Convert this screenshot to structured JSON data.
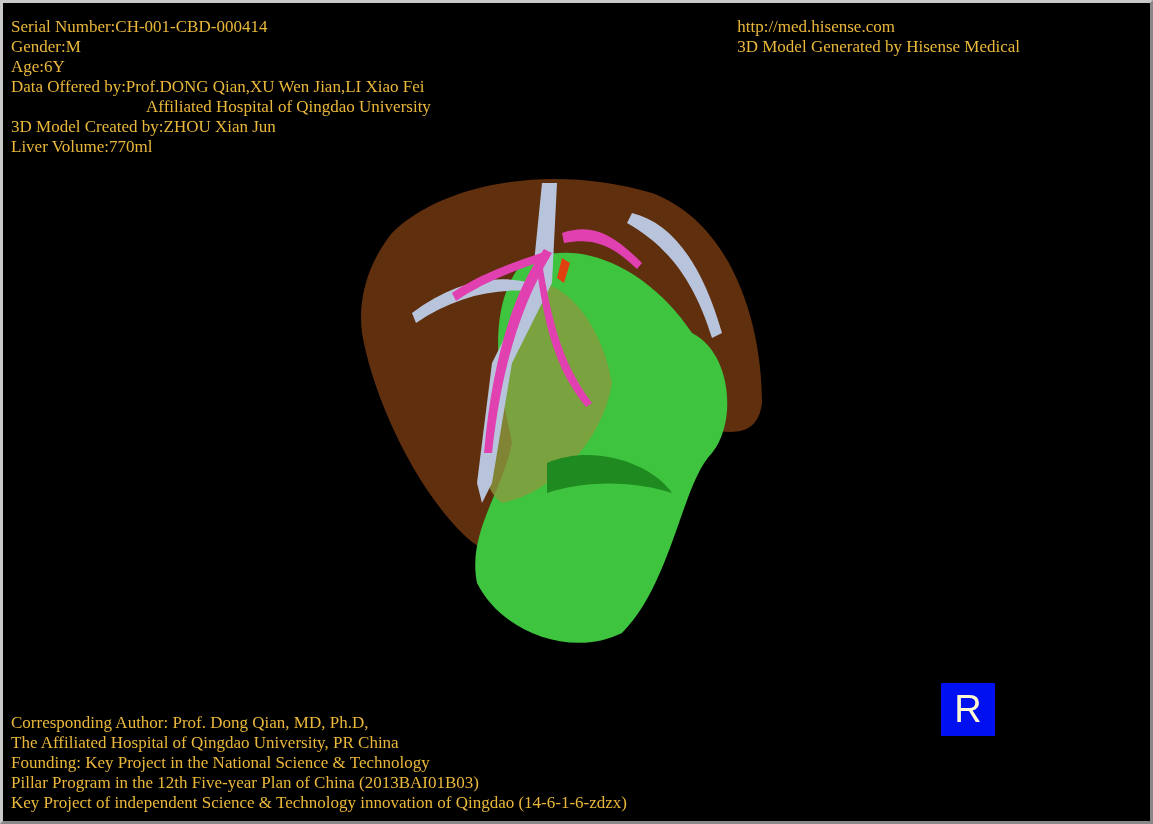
{
  "info_lines": [
    {
      "kind": "line",
      "text": "Serial Number:CH-001-CBD-000414"
    },
    {
      "kind": "line",
      "text": "Gender:M"
    },
    {
      "kind": "line",
      "text": "Age:6Y"
    },
    {
      "kind": "line",
      "text": "Data Offered by:Prof.DONG Qian,XU Wen Jian,LI Xiao Fei"
    },
    {
      "kind": "continuation",
      "text": "Affiliated Hospital of Qingdao University"
    },
    {
      "kind": "line",
      "text": "3D Model Created by:ZHOU Xian Jun"
    },
    {
      "kind": "line",
      "text": "Liver Volume:770ml"
    }
  ],
  "credit_lines": [
    "http://med.hisense.com",
    "3D Model Generated by Hisense Medical"
  ],
  "footer_lines": [
    "Corresponding Author: Prof. Dong Qian, MD, Ph.D,",
    "The Affiliated Hospital of Qingdao University, PR China",
    "Founding: Key Project in the National Science & Technology",
    "Pillar Program in the 12th Five-year Plan of China (2013BAI01B03)",
    "Key Project of independent Science & Technology innovation of Qingdao (14-6-1-6-zdzx)"
  ],
  "orientation_badge": "R"
}
